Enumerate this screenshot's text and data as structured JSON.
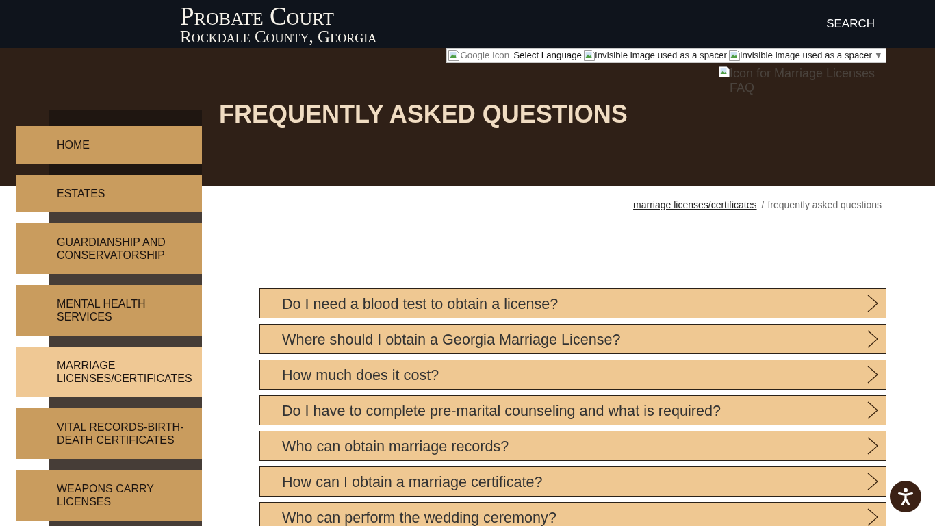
{
  "header": {
    "title": "Probate Court",
    "subtitle": "Rockdale County, Georgia",
    "search": "SEARCH"
  },
  "translate_bar": {
    "google_icon_alt": "Google Icon",
    "label": "Select Language",
    "spacers": [
      "Invisible image used as a spacer",
      "Invisible image used as a spacer"
    ],
    "caret": "▼"
  },
  "banner_image_alt": "Icon for Marriage Licenses FAQ",
  "page_title": "FREQUENTLY ASKED QUESTIONS",
  "sidebar": {
    "items": [
      {
        "label": "HOME",
        "selected": false
      },
      {
        "label": "ESTATES",
        "selected": false
      },
      {
        "label": "GUARDIANSHIP AND CONSERVATORSHIP",
        "selected": false
      },
      {
        "label": "MENTAL HEALTH SERVICES",
        "selected": false
      },
      {
        "label": "MARRIAGE LICENSES/CERTIFICATES",
        "selected": true
      },
      {
        "label": "VITAL RECORDS-BIRTH-DEATH CERTIFICATES",
        "selected": false
      },
      {
        "label": "WEAPONS CARRY LICENSES",
        "selected": false
      }
    ]
  },
  "breadcrumb": {
    "link": "marriage licenses/certificates",
    "separator": "/",
    "current": "frequently asked questions"
  },
  "faq": [
    {
      "question": "Do I need a blood test to obtain a license?",
      "expanded": false
    },
    {
      "question": "Where should I obtain a Georgia Marriage License?",
      "expanded": false
    },
    {
      "question": "How much does it cost?",
      "expanded": false
    },
    {
      "question": "Do I have to complete pre-marital counseling and what is required?",
      "expanded": false
    },
    {
      "question": "Who can obtain marriage records?",
      "expanded": false
    },
    {
      "question": "How can I obtain a marriage certificate?",
      "expanded": false
    },
    {
      "question": "Who can perform the wedding ceremony?",
      "expanded": false
    }
  ]
}
